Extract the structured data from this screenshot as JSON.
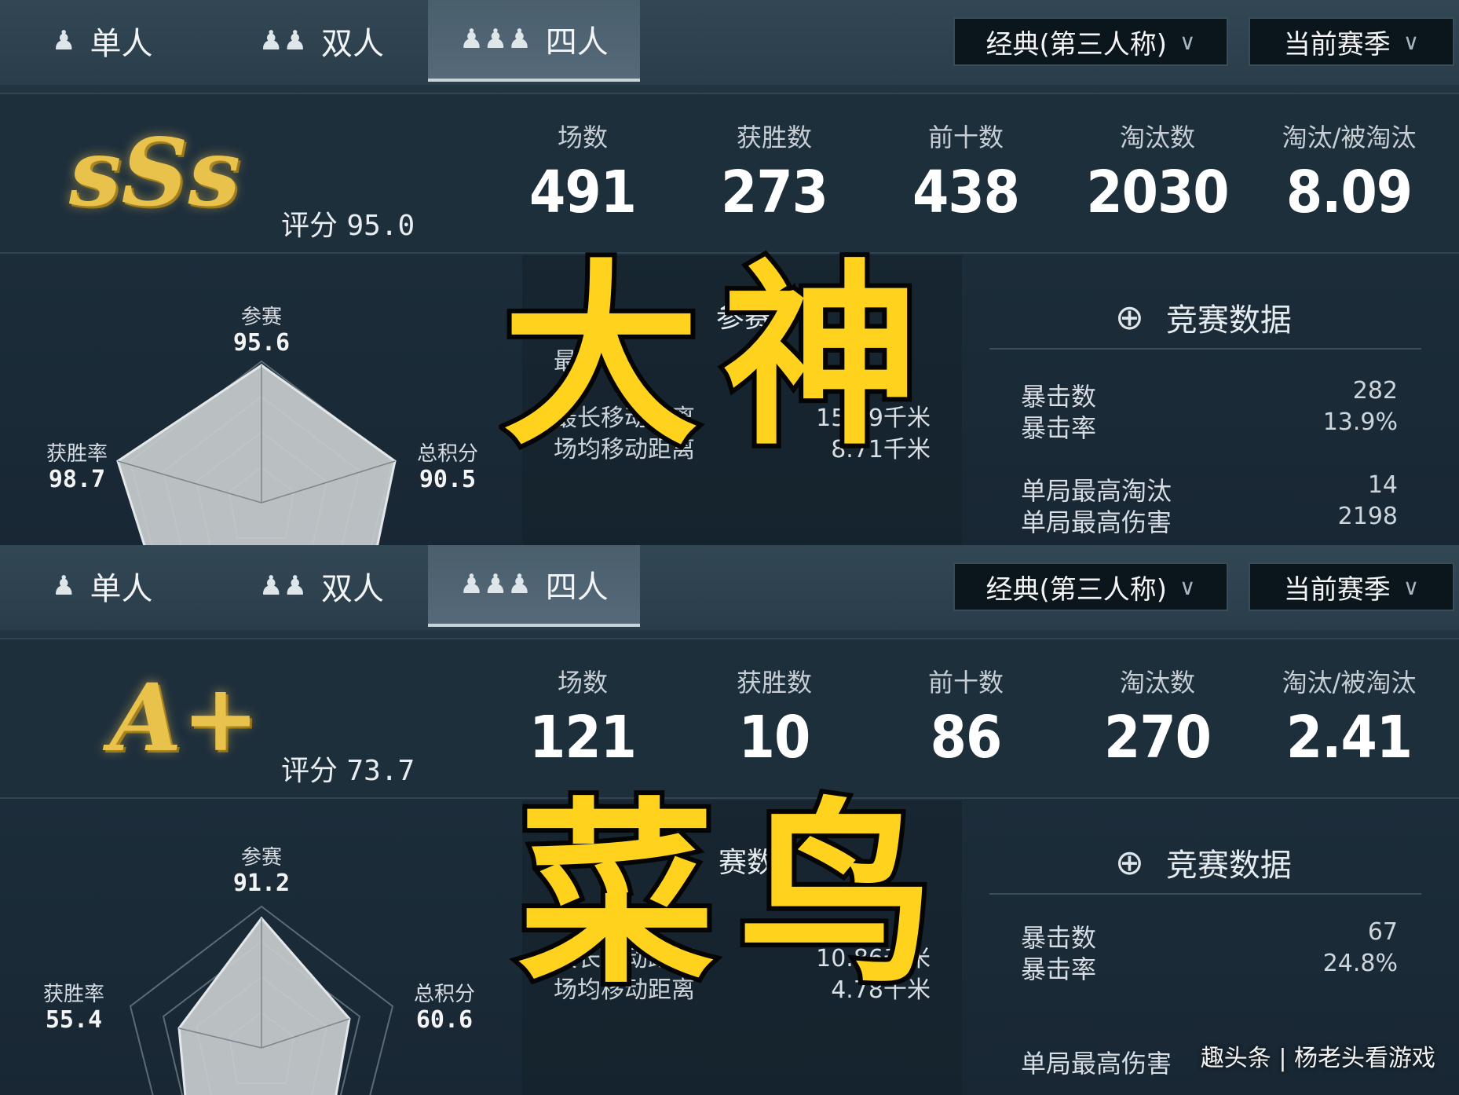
{
  "colors": {
    "overlay_yellow": "#ffd21e",
    "grade_gold": "#e8c24a",
    "panel_bg": "#1e2f3c",
    "radar_fill": "#c8ccce"
  },
  "panels": [
    {
      "tabs": [
        {
          "icon": "single-person-icon",
          "glyph": "♟",
          "label": "单人"
        },
        {
          "icon": "duo-people-icon",
          "glyph": "♟♟",
          "label": "双人"
        },
        {
          "icon": "squad-people-icon",
          "glyph": "♟♟♟",
          "label": "四人",
          "active": true
        }
      ],
      "mode_dropdown": "经典(第三人称)",
      "season_dropdown": "当前赛季",
      "chevron": "∨",
      "grade": "sSs",
      "score_label": "评分",
      "score_value": "95.0",
      "stats": [
        {
          "label": "场数",
          "value": "491"
        },
        {
          "label": "获胜数",
          "value": "273"
        },
        {
          "label": "前十数",
          "value": "438"
        },
        {
          "label": "淘汰数",
          "value": "2030"
        },
        {
          "label": "淘汰/被淘汰",
          "value": "8.09"
        }
      ],
      "radar": {
        "top_label": "参赛",
        "top_value": "95.6",
        "left_label": "获胜率",
        "left_value": "98.7",
        "right_label": "总积分",
        "right_value": "90.5"
      },
      "mid": {
        "header_icon": "bar-chart-icon",
        "header": "参赛",
        "rows": [
          {
            "label": "最",
            "value": ""
          },
          {
            "label": "最长移动距离",
            "value": "15.99千米"
          },
          {
            "label": "场均移动距离",
            "value": "8.71千米"
          }
        ]
      },
      "combat": {
        "header_icon": "crosshair-icon",
        "header": "竞赛数据",
        "rows": [
          {
            "label": "暴击数",
            "value": "282"
          },
          {
            "label": "暴击率",
            "value": "13.9%"
          },
          {
            "label": "单局最高淘汰",
            "value": "14"
          },
          {
            "label": "单局最高伤害",
            "value": "2198"
          }
        ]
      },
      "overlay": "大神"
    },
    {
      "tabs": [
        {
          "icon": "single-person-icon",
          "glyph": "♟",
          "label": "单人"
        },
        {
          "icon": "duo-people-icon",
          "glyph": "♟♟",
          "label": "双人"
        },
        {
          "icon": "squad-people-icon",
          "glyph": "♟♟♟",
          "label": "四人",
          "active": true
        }
      ],
      "mode_dropdown": "经典(第三人称)",
      "season_dropdown": "当前赛季",
      "chevron": "∨",
      "grade": "A+",
      "score_label": "评分",
      "score_value": "73.7",
      "stats": [
        {
          "label": "场数",
          "value": "121"
        },
        {
          "label": "获胜数",
          "value": "10"
        },
        {
          "label": "前十数",
          "value": "86"
        },
        {
          "label": "淘汰数",
          "value": "270"
        },
        {
          "label": "淘汰/被淘汰",
          "value": "2.41"
        }
      ],
      "radar": {
        "top_label": "参赛",
        "top_value": "91.2",
        "left_label": "获胜率",
        "left_value": "55.4",
        "right_label": "总积分",
        "right_value": "60.6"
      },
      "mid": {
        "header_icon": "bar-chart-icon",
        "header": "赛数",
        "rows": [
          {
            "label": "",
            "value": ""
          },
          {
            "label": "最长移动距离",
            "value": "10.86千米"
          },
          {
            "label": "场均移动距离",
            "value": "4.78千米"
          }
        ]
      },
      "combat": {
        "header_icon": "crosshair-icon",
        "header": "竞赛数据",
        "rows": [
          {
            "label": "暴击数",
            "value": "67"
          },
          {
            "label": "暴击率",
            "value": "24.8%"
          },
          {
            "label": "",
            "value": ""
          },
          {
            "label": "单局最高伤害",
            "value": ""
          }
        ]
      },
      "overlay": "菜鸟"
    }
  ],
  "watermark": "趣头条 | 杨老头看游戏"
}
